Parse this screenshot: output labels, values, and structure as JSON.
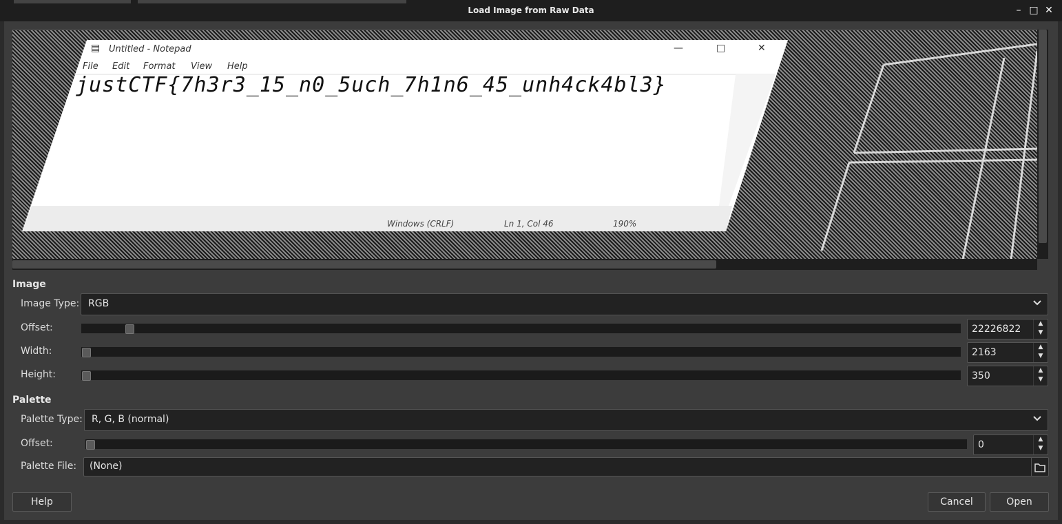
{
  "window": {
    "title": "Load Image from Raw Data"
  },
  "preview": {
    "notepad_title": "Untitled - Notepad",
    "menu": [
      "File",
      "Edit",
      "Format",
      "View",
      "Help"
    ],
    "text": "justCTF{7h3r3_15_n0_5uch_7h1n6_45_unh4ck4bl3}",
    "status": [
      "Windows (CRLF)",
      "Ln 1, Col 46",
      "190%"
    ]
  },
  "image": {
    "section": "Image",
    "type_label": "Image Type:",
    "type_value": "RGB",
    "offset_label": "Offset:",
    "offset_value": "22226822",
    "width_label": "Width:",
    "width_value": "2163",
    "height_label": "Height:",
    "height_value": "350"
  },
  "palette": {
    "section": "Palette",
    "type_label": "Palette Type:",
    "type_value": "R, G, B (normal)",
    "offset_label": "Offset:",
    "offset_value": "0",
    "file_label": "Palette File:",
    "file_value": "(None)"
  },
  "buttons": {
    "help": "Help",
    "cancel": "Cancel",
    "open": "Open"
  }
}
